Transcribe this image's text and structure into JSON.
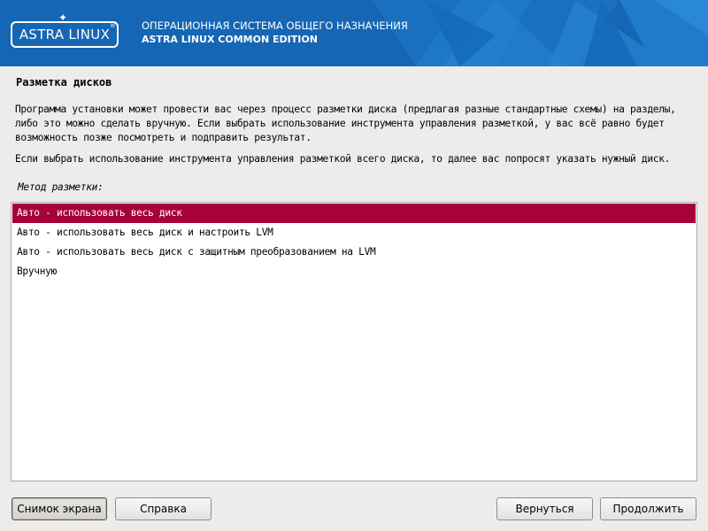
{
  "header": {
    "logo_text": "ASTRA LINUX",
    "logo_reg": "®",
    "line1": "ОПЕРАЦИОННАЯ СИСТЕМА ОБЩЕГО НАЗНАЧЕНИЯ",
    "line2": "ASTRA LINUX COMMON EDITION",
    "colors": {
      "background": "#1566b5",
      "text": "#ffffff"
    }
  },
  "page": {
    "title": "Разметка дисков",
    "paragraph1": "Программа установки может провести вас через процесс разметки диска (предлагая разные стандартные схемы) на разделы, либо это можно сделать вручную. Если выбрать использование инструмента управления разметкой, у вас всё равно будет возможность позже посмотреть и подправить результат.",
    "paragraph2": "Если выбрать использование инструмента управления разметкой всего диска, то далее вас попросят указать нужный диск.",
    "method_label": "Метод разметки:"
  },
  "partition_methods": {
    "items": [
      {
        "label": "Авто - использовать весь диск",
        "selected": true
      },
      {
        "label": "Авто - использовать весь диск и настроить LVM",
        "selected": false
      },
      {
        "label": "Авто - использовать весь диск с защитным преобразованием на LVM",
        "selected": false
      },
      {
        "label": "Вручную",
        "selected": false
      }
    ],
    "selected_color": "#a8003b"
  },
  "buttons": {
    "screenshot": "Снимок экрана",
    "help": "Справка",
    "back": "Вернуться",
    "continue": "Продолжить"
  }
}
